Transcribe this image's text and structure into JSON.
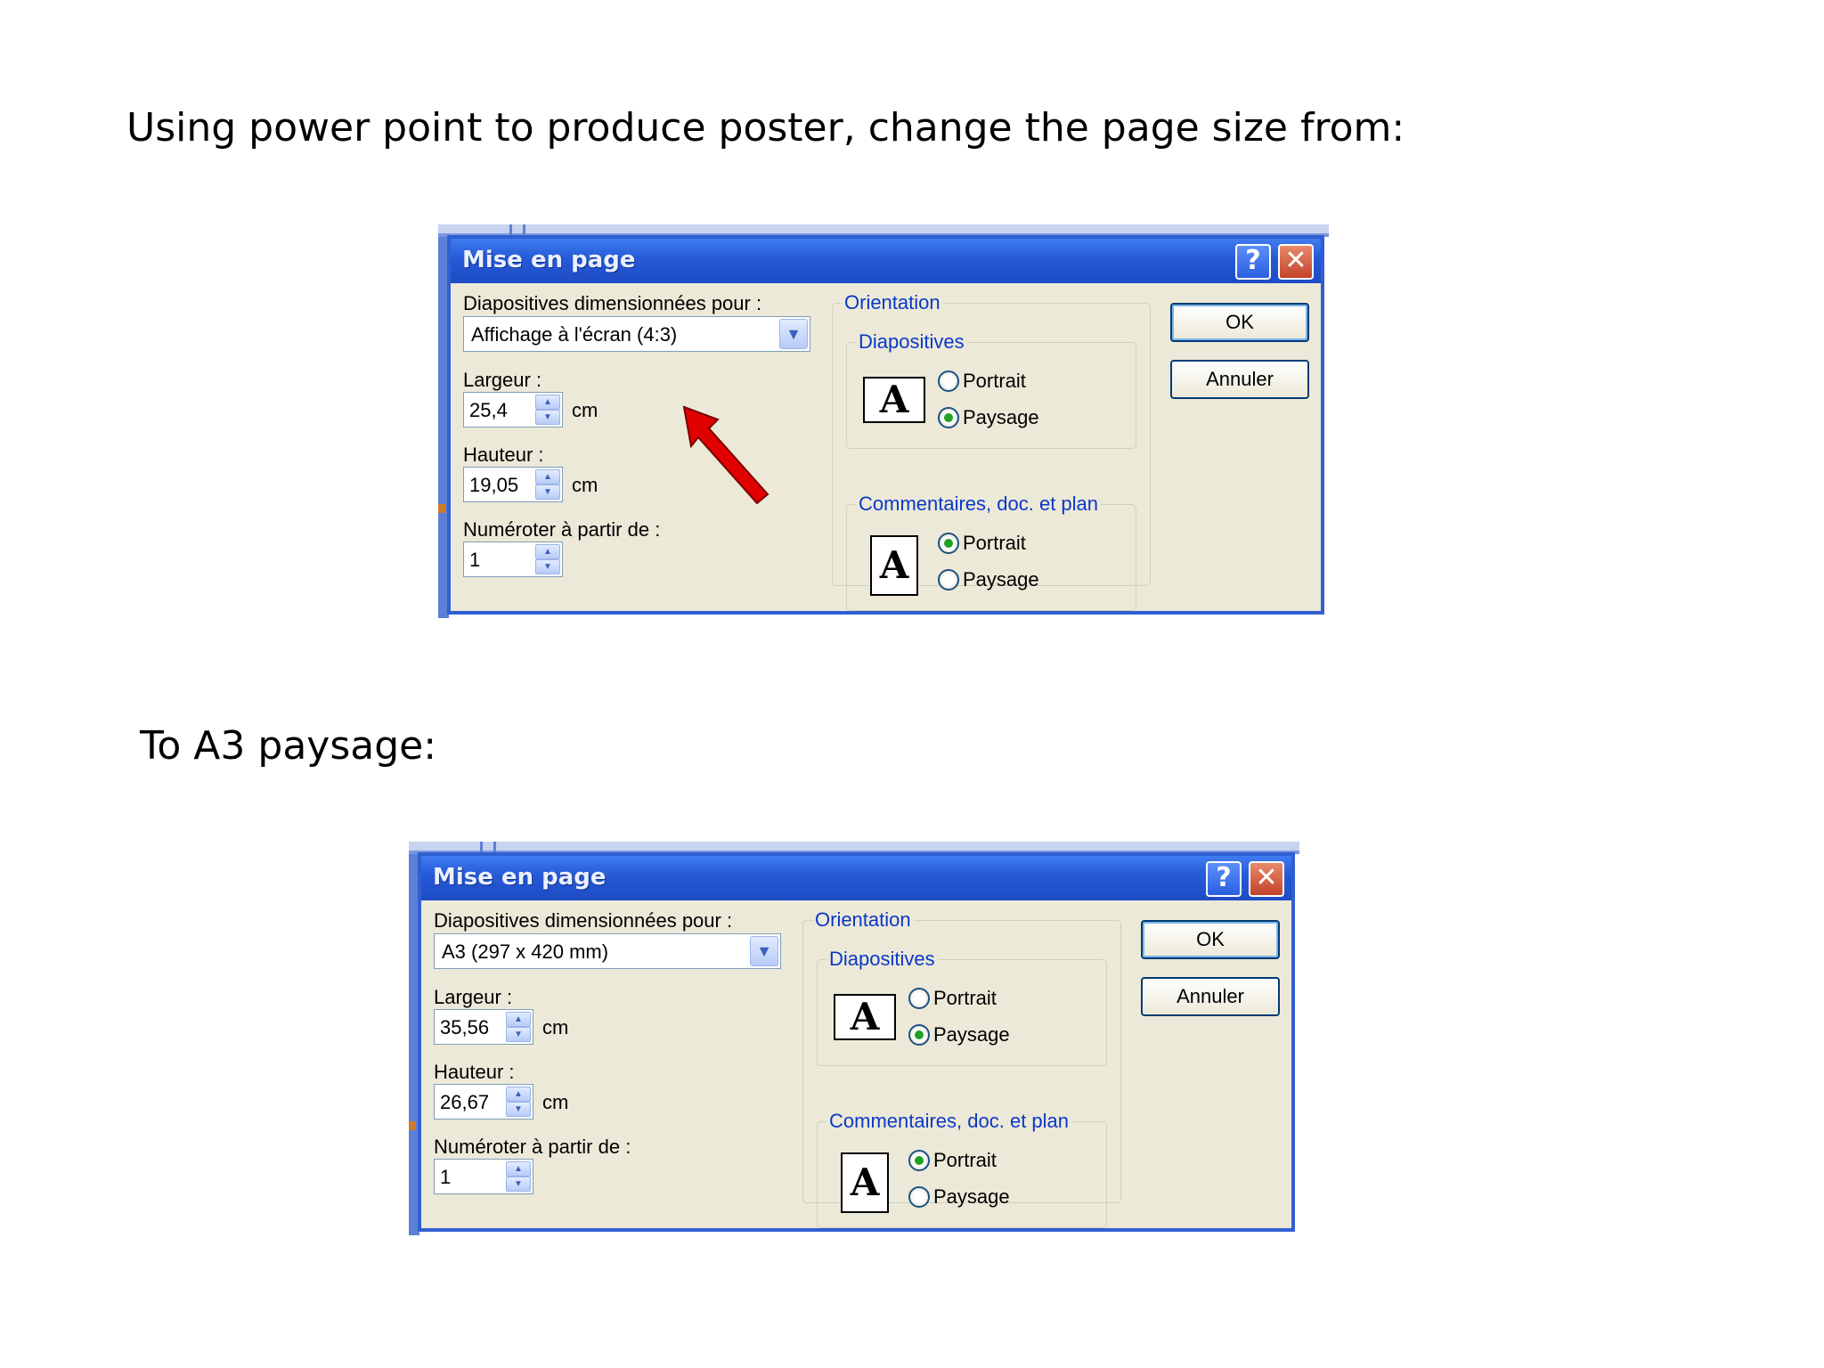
{
  "slide": {
    "heading_1": "Using power point to produce poster, change the page size from:",
    "heading_2": "To A3 paysage:"
  },
  "dialogs": [
    {
      "title": "Mise en page",
      "help_icon": "?",
      "close_icon": "✕",
      "size_label": "Diapositives dimensionnées pour :",
      "size_value": "Affichage à l'écran (4:3)",
      "width_label": "Largeur :",
      "width_value": "25,4",
      "width_unit": "cm",
      "height_label": "Hauteur :",
      "height_value": "19,05",
      "height_unit": "cm",
      "number_label": "Numéroter à partir de :",
      "number_value": "1",
      "orientation_group": "Orientation",
      "slides_group": "Diapositives",
      "slides_portrait": "Portrait",
      "slides_landscape": "Paysage",
      "slides_selected": "Paysage",
      "notes_group": "Commentaires, doc. et plan",
      "notes_portrait": "Portrait",
      "notes_landscape": "Paysage",
      "notes_selected": "Portrait",
      "ok_label": "OK",
      "cancel_label": "Annuler",
      "page_glyph": "A"
    },
    {
      "title": "Mise en page",
      "help_icon": "?",
      "close_icon": "✕",
      "size_label": "Diapositives dimensionnées pour :",
      "size_value": "A3 (297 x 420 mm)",
      "width_label": "Largeur :",
      "width_value": "35,56",
      "width_unit": "cm",
      "height_label": "Hauteur :",
      "height_value": "26,67",
      "height_unit": "cm",
      "number_label": "Numéroter à partir de :",
      "number_value": "1",
      "orientation_group": "Orientation",
      "slides_group": "Diapositives",
      "slides_portrait": "Portrait",
      "slides_landscape": "Paysage",
      "slides_selected": "Paysage",
      "notes_group": "Commentaires, doc. et plan",
      "notes_portrait": "Portrait",
      "notes_landscape": "Paysage",
      "notes_selected": "Portrait",
      "ok_label": "OK",
      "cancel_label": "Annuler",
      "page_glyph": "A"
    }
  ],
  "annotation": {
    "arrow_icon": "red-arrow-icon",
    "arrow_color": "#e00000"
  },
  "colors": {
    "titlebar": "#2659d6",
    "dialog_bg": "#ece9d8",
    "group_text": "#0a38c8",
    "radio_selected": "#21a121"
  }
}
